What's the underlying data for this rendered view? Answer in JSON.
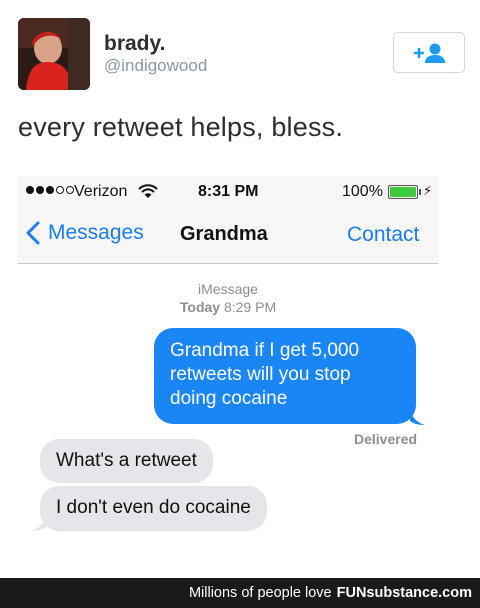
{
  "tweet": {
    "display_name": "brady.",
    "handle": "@indigowood",
    "text": "every retweet helps, bless.",
    "follow_icon": "add-user-icon"
  },
  "phone": {
    "status_bar": {
      "carrier": "Verizon",
      "time": "8:31 PM",
      "battery": "100%",
      "battery_level": 1.0
    },
    "nav": {
      "back_label": "Messages",
      "title": "Grandma",
      "action_label": "Contact"
    },
    "thread": {
      "service": "iMessage",
      "day": "Today",
      "time": "8:29 PM",
      "messages": [
        {
          "direction": "out",
          "text_lines": [
            "Grandma if I get 5,000",
            "retweets will you stop",
            "doing cocaine"
          ]
        },
        {
          "direction": "in",
          "text": "What's a retweet"
        },
        {
          "direction": "in",
          "text": "I don't even do cocaine"
        }
      ],
      "status": "Delivered"
    }
  },
  "footer": {
    "lead": "Millions of people love",
    "brand": "FUNsubstance.com"
  },
  "colors": {
    "ios_blue": "#1a86f5",
    "incoming_bubble": "#e5e5ea",
    "battery_green": "#3ec93e"
  }
}
